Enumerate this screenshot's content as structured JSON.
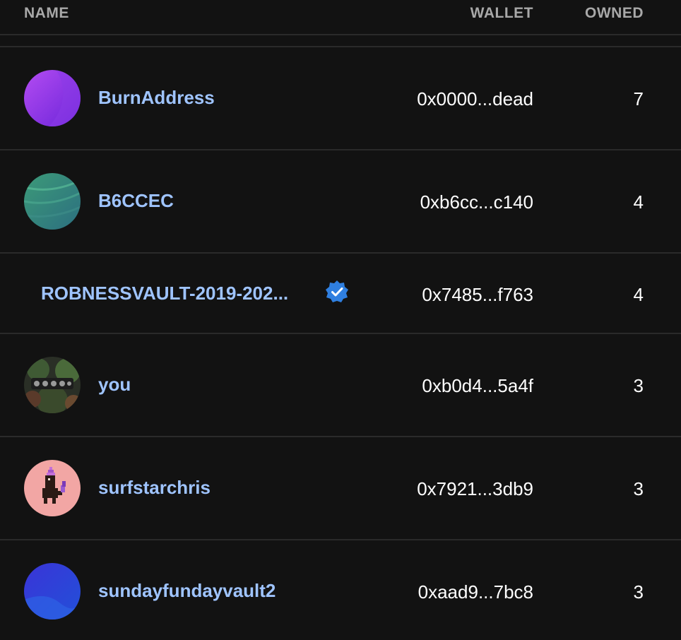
{
  "columns": {
    "name": "NAME",
    "wallet": "WALLET",
    "owned": "OWNED"
  },
  "rows": [
    {
      "name": "BurnAddress",
      "wallet": "0x0000...dead",
      "owned": "7",
      "avatar": "purple-gradient-avatar"
    },
    {
      "name": "B6CCEC",
      "wallet": "0xb6cc...c140",
      "owned": "4",
      "avatar": "green-wave-avatar"
    },
    {
      "name": "ROBNESSVAULT-2019-202...",
      "wallet": "0x7485...f763",
      "owned": "4",
      "verified": true,
      "avatar": "none"
    },
    {
      "name": "you",
      "wallet": "0xb0d4...5a4f",
      "owned": "3",
      "avatar": "photo-avatar"
    },
    {
      "name": "surfstarchris",
      "wallet": "0x7921...3db9",
      "owned": "3",
      "avatar": "pixel-dino-avatar"
    },
    {
      "name": "sundayfundayvault2",
      "wallet": "0xaad9...7bc8",
      "owned": "3",
      "avatar": "blue-gradient-avatar"
    }
  ],
  "colors": {
    "background": "#121212",
    "header_text": "#a8a8a8",
    "name_link": "#9fc4ff",
    "divider": "#2a2a2a",
    "verified_badge": "#2f7fe0"
  }
}
